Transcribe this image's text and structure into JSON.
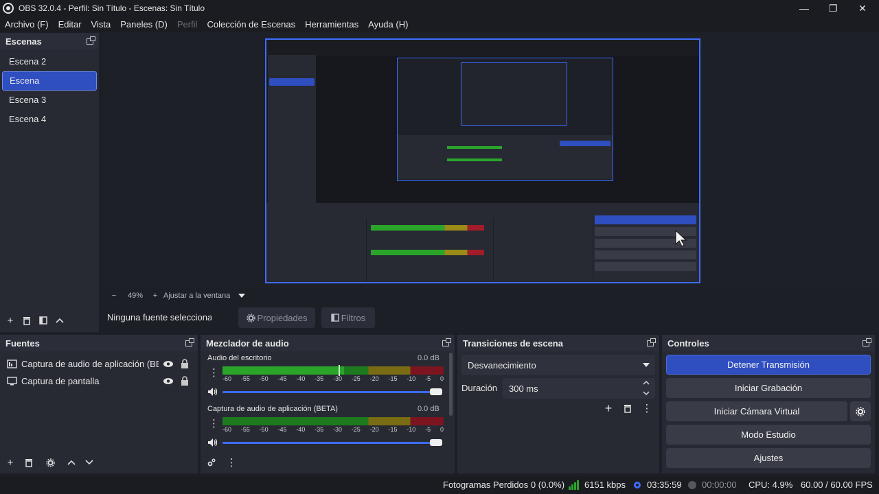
{
  "window": {
    "title": "OBS 32.0.4 - Perfil: Sin Título - Escenas: Sin Título",
    "minimize": "—",
    "maximize": "❐",
    "close": "✕"
  },
  "menu": [
    {
      "label": "Archivo (F)",
      "disabled": false
    },
    {
      "label": "Editar",
      "disabled": false
    },
    {
      "label": "Vista",
      "disabled": false
    },
    {
      "label": "Paneles (D)",
      "disabled": false
    },
    {
      "label": "Perfil",
      "disabled": true
    },
    {
      "label": "Colección de Escenas",
      "disabled": false
    },
    {
      "label": "Herramientas",
      "disabled": false
    },
    {
      "label": "Ayuda (H)",
      "disabled": false
    }
  ],
  "scenes": {
    "title": "Escenas",
    "items": [
      "Escena 2",
      "Escena",
      "Escena 3",
      "Escena 4"
    ],
    "selected": 1
  },
  "preview": {
    "zoom_minus": "−",
    "zoom": "49%",
    "zoom_plus": "+",
    "fit": "Ajustar a la ventana"
  },
  "source_bar": {
    "no_source": "Ninguna fuente seleccionada",
    "properties": "Propiedades",
    "filters": "Filtros"
  },
  "sources": {
    "title": "Fuentes",
    "items": [
      "Captura de audio de aplicación (BETA)",
      "Captura de pantalla"
    ]
  },
  "mixer": {
    "title": "Mezclador de audio",
    "channels": [
      {
        "name": "Audio del escritorio",
        "db": "0.0 dB",
        "level": 0.55
      },
      {
        "name": "Captura de audio de aplicación (BETA)",
        "db": "0.0 dB",
        "level": 0.0
      }
    ],
    "ticks": [
      "-60",
      "-55",
      "-50",
      "-45",
      "-40",
      "-35",
      "-30",
      "-25",
      "-20",
      "-15",
      "-10",
      "-5",
      "0"
    ]
  },
  "transitions": {
    "title": "Transiciones de escena",
    "selected": "Desvanecimiento",
    "duration_label": "Duración",
    "duration_value": "300 ms"
  },
  "controls": {
    "title": "Controles",
    "buttons": [
      "Detener Transmisión",
      "Iniciar Grabación",
      "Iniciar Cámara Virtual",
      "Modo Estudio",
      "Ajustes"
    ]
  },
  "status": {
    "dropped": "Fotogramas Perdidos 0 (0.0%)",
    "bitrate": "6151 kbps",
    "stream_time": "03:35:59",
    "rec_time": "00:00:00",
    "cpu": "CPU: 4.9%",
    "fps": "60.00 / 60.00 FPS"
  },
  "colors": {
    "accent": "#2f4fc1",
    "panel": "#272a33",
    "meter_green": "#2aa52a",
    "meter_yellow": "#9a8a18",
    "meter_red": "#a21c2a"
  }
}
